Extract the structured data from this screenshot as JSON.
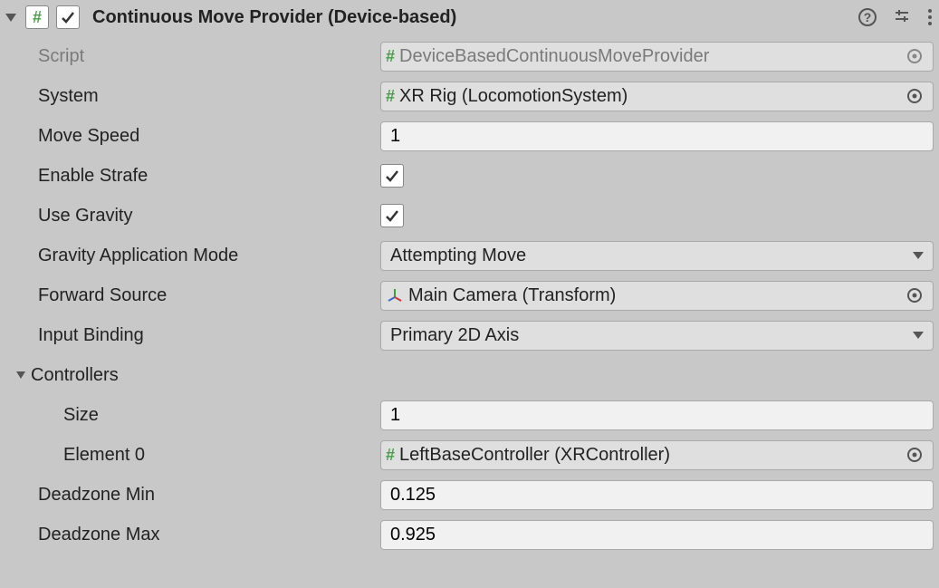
{
  "header": {
    "title": "Continuous Move Provider (Device-based)",
    "enabled": true
  },
  "script": {
    "label": "Script",
    "value": "DeviceBasedContinuousMoveProvider"
  },
  "system": {
    "label": "System",
    "value": "XR Rig (LocomotionSystem)"
  },
  "moveSpeed": {
    "label": "Move Speed",
    "value": "1"
  },
  "enableStrafe": {
    "label": "Enable Strafe",
    "value": true
  },
  "useGravity": {
    "label": "Use Gravity",
    "value": true
  },
  "gravityMode": {
    "label": "Gravity Application Mode",
    "value": "Attempting Move"
  },
  "forwardSource": {
    "label": "Forward Source",
    "value": "Main Camera (Transform)"
  },
  "inputBinding": {
    "label": "Input Binding",
    "value": "Primary 2D Axis"
  },
  "controllers": {
    "label": "Controllers",
    "sizeLabel": "Size",
    "size": "1",
    "element0Label": "Element 0",
    "element0Value": "LeftBaseController (XRController)"
  },
  "deadzoneMin": {
    "label": "Deadzone Min",
    "value": "0.125"
  },
  "deadzoneMax": {
    "label": "Deadzone Max",
    "value": "0.925"
  }
}
